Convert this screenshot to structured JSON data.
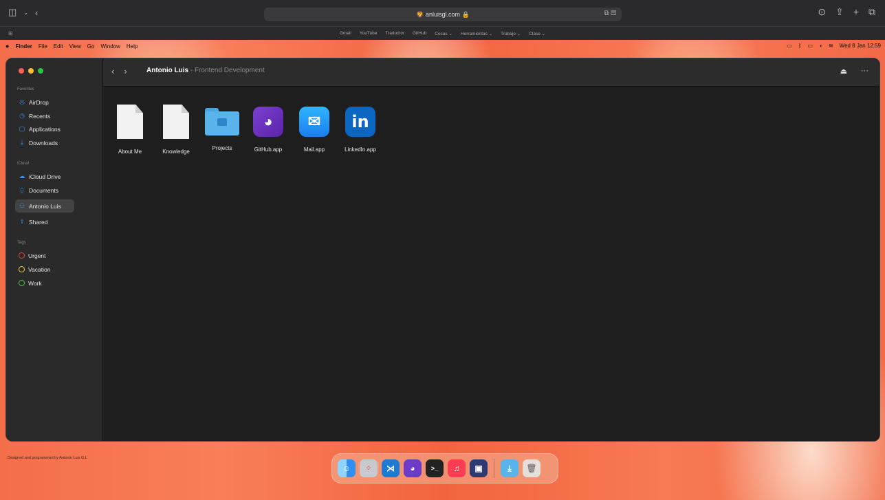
{
  "safari": {
    "url": "🦁 anluisgl.com 🔒",
    "bookmarks": [
      "Gmail",
      "YouTube",
      "Traductor",
      "GitHub",
      "Cosas ⌄",
      "Herramientas ⌄",
      "Trabajo ⌄",
      "Clase ⌄"
    ]
  },
  "menubar": {
    "apple": "",
    "app": "Finder",
    "items": [
      "File",
      "Edit",
      "View",
      "Go",
      "Window",
      "Help"
    ],
    "datetime": "Wed 8 Jan 12:59"
  },
  "finder": {
    "sidebar": {
      "favorites_title": "Favorites",
      "favorites": [
        {
          "label": "AirDrop",
          "icon": "airdrop-icon",
          "glyph": "◎"
        },
        {
          "label": "Recents",
          "icon": "clock-icon",
          "glyph": "◷"
        },
        {
          "label": "Applications",
          "icon": "applications-icon",
          "glyph": "▢"
        },
        {
          "label": "Downloads",
          "icon": "download-icon",
          "glyph": "⤓"
        }
      ],
      "icloud_title": "iCloud",
      "icloud": [
        {
          "label": "iCloud Drive",
          "icon": "cloud-icon",
          "glyph": "☁"
        },
        {
          "label": "Documents",
          "icon": "document-icon",
          "glyph": "▯"
        },
        {
          "label": "Antonio Luis",
          "icon": "user-icon",
          "glyph": "⚇"
        },
        {
          "label": "Shared",
          "icon": "shared-icon",
          "glyph": "⇪"
        }
      ],
      "tags_title": "Tags",
      "tags": [
        {
          "label": "Urgent",
          "color": "#e5463b"
        },
        {
          "label": "Vacation",
          "color": "#e8d23a"
        },
        {
          "label": "Work",
          "color": "#46c94f"
        }
      ]
    },
    "breadcrumb": {
      "name": "Antonio Luis",
      "subtitle": " - Frontend Development"
    },
    "files": [
      {
        "label": "About Me",
        "kind": "document"
      },
      {
        "label": "Knowledge",
        "kind": "document"
      },
      {
        "label": "Projects",
        "kind": "folder"
      },
      {
        "label": "GitHub.app",
        "kind": "app"
      },
      {
        "label": "Mail.app",
        "kind": "app"
      },
      {
        "label": "LinkedIn.app",
        "kind": "app"
      }
    ]
  },
  "footer": {
    "credit": "Designed and programmed by Antonio Luis G.L"
  },
  "dock": {
    "apps": [
      "Finder",
      "Launchpad",
      "VS Code",
      "GitHub",
      "Terminal",
      "Music",
      "VirtualBox",
      "Downloads",
      "Trash"
    ]
  }
}
